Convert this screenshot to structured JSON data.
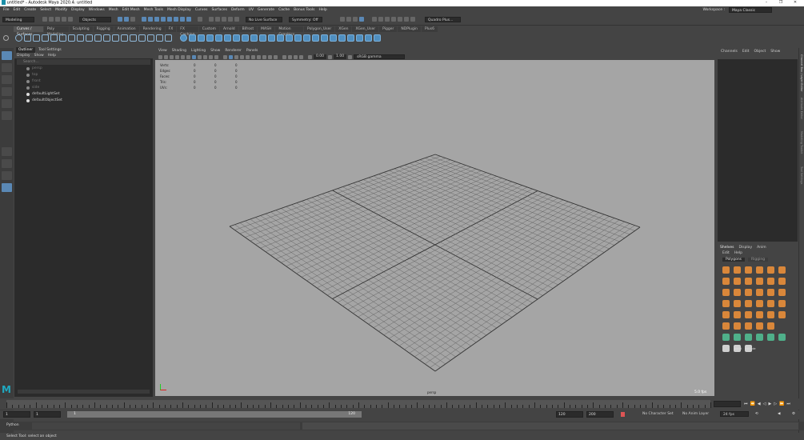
{
  "window": {
    "title": "untitled* - Autodesk Maya 2020.4: untitled"
  },
  "menubar": [
    "File",
    "Edit",
    "Create",
    "Select",
    "Modify",
    "Display",
    "Windows",
    "Mesh",
    "Edit Mesh",
    "Mesh Tools",
    "Mesh Display",
    "Curves",
    "Surfaces",
    "Deform",
    "UV",
    "Generate",
    "Cache",
    "Bonus Tools",
    "Help"
  ],
  "statusline": {
    "mode": "Modeling",
    "selection_mode": "Objects",
    "live_surface": "No Live Surface",
    "symmetry": "Symmetry: Off",
    "renderer": "Quadro Plus..."
  },
  "workspace": {
    "label": "Workspace :",
    "value": "Maya Classic"
  },
  "shelf_tabs": [
    "Curves / Surfaces",
    "Poly Modeling",
    "Sculpting",
    "Rigging",
    "Animation",
    "Rendering",
    "FX",
    "FX Caching",
    "Custom",
    "Arnold",
    "Bifrost",
    "MASH",
    "Motion Graphics",
    "Polygon_User",
    "XGen",
    "XGen_User",
    "Pigger",
    "NDPlugin",
    "Plus6"
  ],
  "shelf_active": "Curves / Surfaces",
  "outliner": {
    "tabs": [
      "Outliner",
      "Tool Settings"
    ],
    "menu": [
      "Display",
      "Show",
      "Help"
    ],
    "search_placeholder": "Search...",
    "items": [
      {
        "name": "persp",
        "visible": false
      },
      {
        "name": "top",
        "visible": false
      },
      {
        "name": "front",
        "visible": false
      },
      {
        "name": "side",
        "visible": false
      },
      {
        "name": "defaultLightSet",
        "visible": true
      },
      {
        "name": "defaultObjectSet",
        "visible": true
      }
    ]
  },
  "viewport": {
    "menu": [
      "View",
      "Shading",
      "Lighting",
      "Show",
      "Renderer",
      "Panels"
    ],
    "gamma_value1": "0.00",
    "gamma_value2": "1.00",
    "colorspace": "sRGB gamma",
    "hud": [
      {
        "label": "Verts:",
        "a": "0",
        "b": "0",
        "c": "0"
      },
      {
        "label": "Edges:",
        "a": "0",
        "b": "0",
        "c": "0"
      },
      {
        "label": "Faces:",
        "a": "0",
        "b": "0",
        "c": "0"
      },
      {
        "label": "Tris:",
        "a": "0",
        "b": "0",
        "c": "0"
      },
      {
        "label": "UVs:",
        "a": "0",
        "b": "0",
        "c": "0"
      }
    ],
    "camera": "persp",
    "fps": "5.0 fps"
  },
  "channel_box": {
    "menu": [
      "Channels",
      "Edit",
      "Object",
      "Show"
    ]
  },
  "right_strip": [
    "Channel Box / Layer Editor",
    "Attribute Editor",
    "Modeling Toolkit",
    "Tool Settings"
  ],
  "shelf_panel": {
    "tabs": [
      "Shelves",
      "Display",
      "Anim"
    ],
    "menu": [
      "Edit",
      "Help"
    ],
    "subtabs": [
      "Polygons",
      "Rigging"
    ],
    "labels": [
      "bend",
      "extrude"
    ]
  },
  "time": {
    "start": "1",
    "start2": "1",
    "range_val": "1",
    "range_end": "120",
    "end": "120",
    "end2": "200",
    "character_set": "No Character Set",
    "anim_layer": "No Anim Layer",
    "fps_menu": "24 fps"
  },
  "cmdline": {
    "label": "Python"
  },
  "helpline": "Select Tool: select an object"
}
